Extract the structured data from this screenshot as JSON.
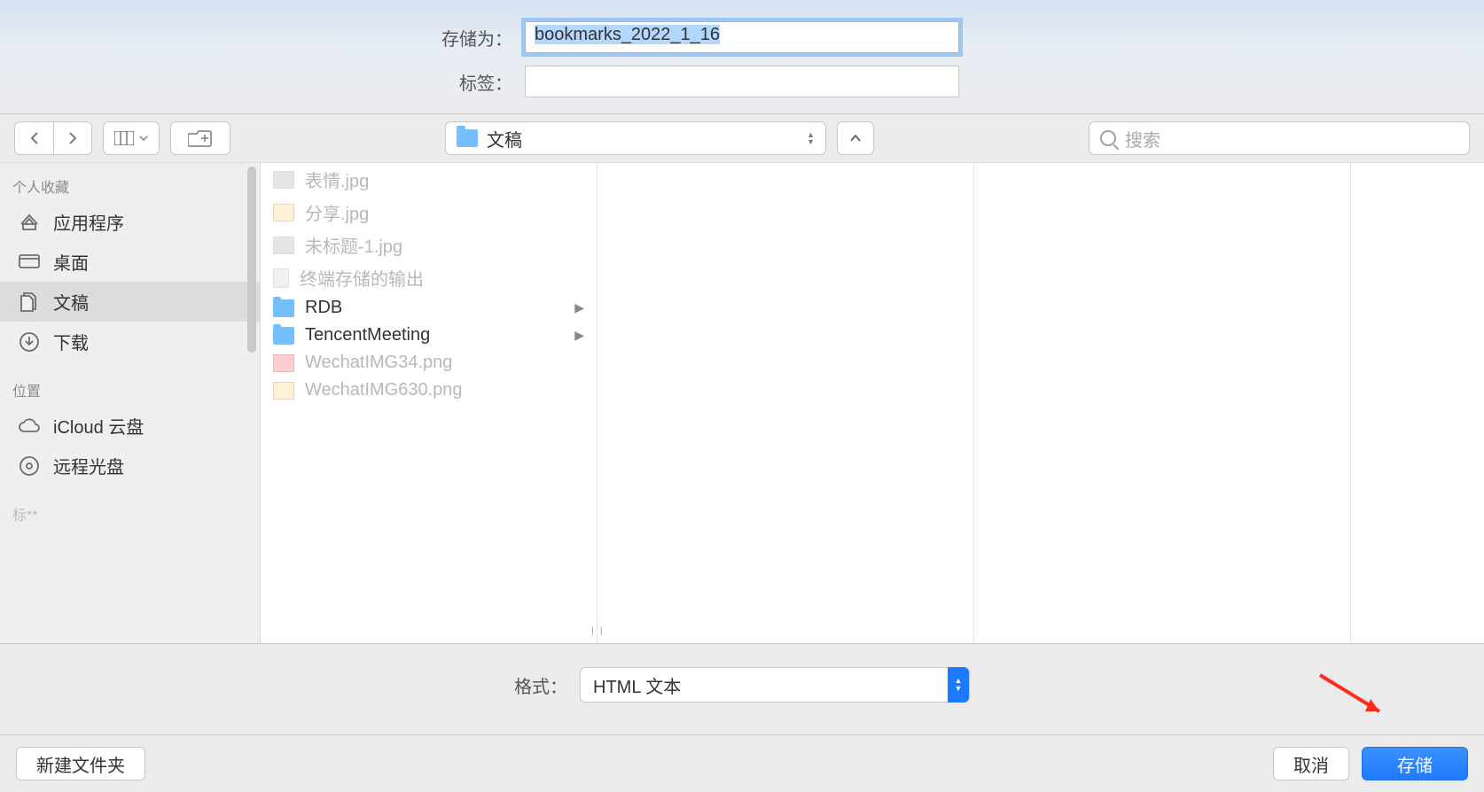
{
  "save_as_label": "存储为：",
  "save_as_value": "bookmarks_2022_1_16",
  "tags_label": "标签：",
  "tags_value": "",
  "current_folder": "文稿",
  "search_placeholder": "搜索",
  "sidebar": {
    "section_favorites": "个人收藏",
    "items_favorites": [
      {
        "label": "应用程序",
        "icon": "apps"
      },
      {
        "label": "桌面",
        "icon": "desktop"
      },
      {
        "label": "文稿",
        "icon": "documents",
        "selected": true
      },
      {
        "label": "下载",
        "icon": "downloads"
      }
    ],
    "section_locations": "位置",
    "items_locations": [
      {
        "label": "iCloud 云盘",
        "icon": "cloud"
      },
      {
        "label": "远程光盘",
        "icon": "disc"
      }
    ],
    "truncated": "标**"
  },
  "file_list": [
    {
      "name": "表情.jpg",
      "kind": "img-dim",
      "dim": true
    },
    {
      "name": "分享.jpg",
      "kind": "col",
      "dim": true
    },
    {
      "name": "未标题-1.jpg",
      "kind": "img-dim",
      "dim": true
    },
    {
      "name": "终端存储的输出",
      "kind": "doc-dim",
      "dim": true
    },
    {
      "name": "RDB",
      "kind": "folder",
      "folder": true
    },
    {
      "name": "TencentMeeting",
      "kind": "folder",
      "folder": true
    },
    {
      "name": "WechatIMG34.png",
      "kind": "pink",
      "dim": true
    },
    {
      "name": "WechatIMG630.png",
      "kind": "col",
      "dim": true
    }
  ],
  "format_label": "格式：",
  "format_value": "HTML 文本",
  "new_folder_label": "新建文件夹",
  "cancel_label": "取消",
  "save_label": "存储"
}
